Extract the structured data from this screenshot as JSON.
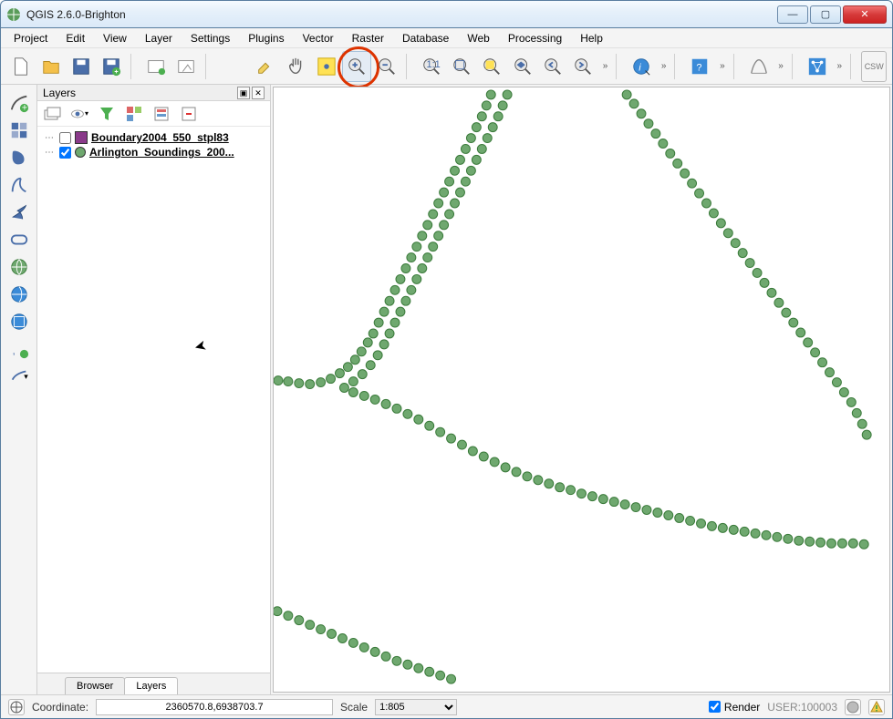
{
  "window": {
    "title": "QGIS 2.6.0-Brighton"
  },
  "menu": [
    "Project",
    "Edit",
    "View",
    "Layer",
    "Settings",
    "Plugins",
    "Vector",
    "Raster",
    "Database",
    "Web",
    "Processing",
    "Help"
  ],
  "panel": {
    "title": "Layers",
    "tabs": [
      {
        "label": "Browser",
        "active": false
      },
      {
        "label": "Layers",
        "active": true
      }
    ],
    "layers": [
      {
        "name": "Boundary2004_550_stpl83",
        "checked": false,
        "swatch": "sq"
      },
      {
        "name": "Arlington_Soundings_200...",
        "checked": true,
        "swatch": "pt"
      }
    ]
  },
  "status": {
    "coord_label": "Coordinate:",
    "coord_value": "2360570.8,6938703.7",
    "scale_label": "Scale",
    "scale_value": "1:805",
    "render_label": "Render",
    "render_checked": true,
    "crs": "USER:100003"
  }
}
